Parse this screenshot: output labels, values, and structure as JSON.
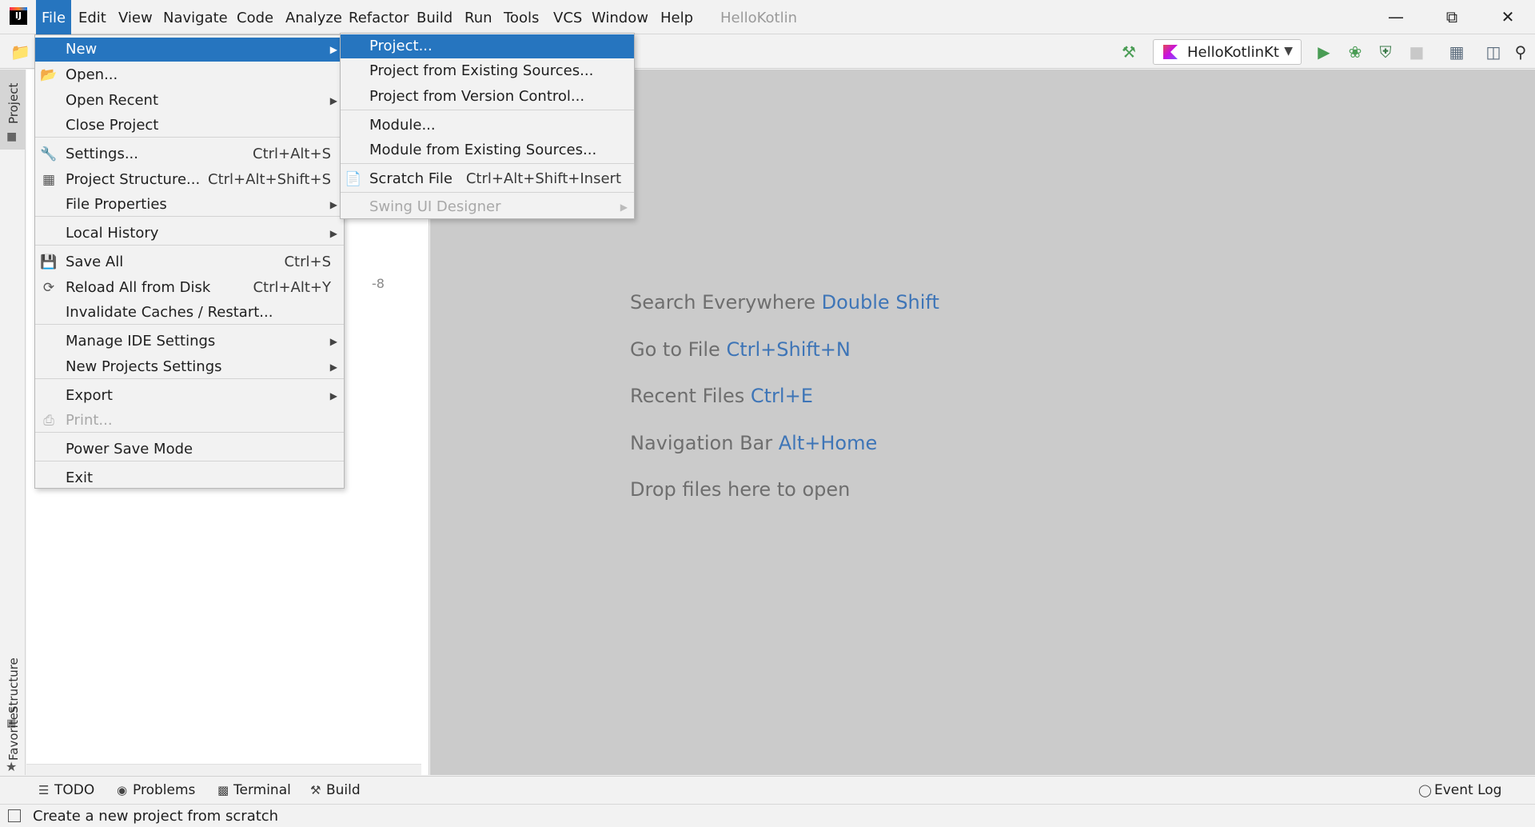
{
  "menubar": {
    "items": [
      {
        "label": "File"
      },
      {
        "label": "Edit"
      },
      {
        "label": "View"
      },
      {
        "label": "Navigate"
      },
      {
        "label": "Code"
      },
      {
        "label": "Analyze"
      },
      {
        "label": "Refactor"
      },
      {
        "label": "Build"
      },
      {
        "label": "Run"
      },
      {
        "label": "Tools"
      },
      {
        "label": "VCS"
      },
      {
        "label": "Window"
      },
      {
        "label": "Help"
      }
    ],
    "window_title": "HelloKotlin"
  },
  "toolbar": {
    "run_config": "HelloKotlinKt"
  },
  "file_menu": {
    "items": [
      {
        "label": "New",
        "shortcut": ""
      },
      {
        "label": "Open...",
        "shortcut": ""
      },
      {
        "label": "Open Recent",
        "shortcut": ""
      },
      {
        "label": "Close Project",
        "shortcut": ""
      },
      {
        "label": "Settings...",
        "shortcut": "Ctrl+Alt+S"
      },
      {
        "label": "Project Structure...",
        "shortcut": "Ctrl+Alt+Shift+S"
      },
      {
        "label": "File Properties",
        "shortcut": ""
      },
      {
        "label": "Local History",
        "shortcut": ""
      },
      {
        "label": "Save All",
        "shortcut": "Ctrl+S"
      },
      {
        "label": "Reload All from Disk",
        "shortcut": "Ctrl+Alt+Y"
      },
      {
        "label": "Invalidate Caches / Restart...",
        "shortcut": ""
      },
      {
        "label": "Manage IDE Settings",
        "shortcut": ""
      },
      {
        "label": "New Projects Settings",
        "shortcut": ""
      },
      {
        "label": "Export",
        "shortcut": ""
      },
      {
        "label": "Print...",
        "shortcut": ""
      },
      {
        "label": "Power Save Mode",
        "shortcut": ""
      },
      {
        "label": "Exit",
        "shortcut": ""
      }
    ]
  },
  "new_submenu": {
    "items": [
      {
        "label": "Project...",
        "shortcut": ""
      },
      {
        "label": "Project from Existing Sources...",
        "shortcut": ""
      },
      {
        "label": "Project from Version Control...",
        "shortcut": ""
      },
      {
        "label": "Module...",
        "shortcut": ""
      },
      {
        "label": "Module from Existing Sources...",
        "shortcut": ""
      },
      {
        "label": "Scratch File",
        "shortcut": "Ctrl+Alt+Shift+Insert"
      },
      {
        "label": "Swing UI Designer",
        "shortcut": ""
      }
    ]
  },
  "side_tabs": {
    "project": "Project",
    "structure": "Structure",
    "favorites": "Favorites"
  },
  "project_panel": {
    "fragment": "-8"
  },
  "editor_hints": [
    {
      "text": "Search Everywhere",
      "key": "Double Shift"
    },
    {
      "text": "Go to File",
      "key": "Ctrl+Shift+N"
    },
    {
      "text": "Recent Files",
      "key": "Ctrl+E"
    },
    {
      "text": "Navigation Bar",
      "key": "Alt+Home"
    },
    {
      "text": "Drop files here to open",
      "key": ""
    }
  ],
  "bottom_tabs": {
    "todo": "TODO",
    "problems": "Problems",
    "terminal": "Terminal",
    "build": "Build",
    "event_log": "Event Log"
  },
  "status_bar": {
    "text": "Create a new project from scratch"
  },
  "colors": {
    "selection": "#2675bf",
    "shortcut_key": "#3e75b7",
    "run_green": "#499c54",
    "editor_bg": "#cbcbcb"
  }
}
